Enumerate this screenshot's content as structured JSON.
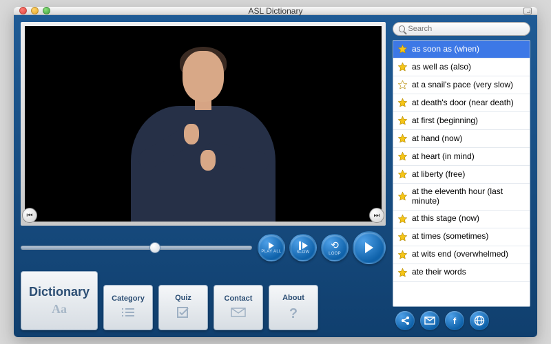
{
  "window": {
    "title": "ASL Dictionary"
  },
  "search": {
    "placeholder": "Search"
  },
  "controls": {
    "playall": "PLAY ALL",
    "slow": "SLOW",
    "loop": "LOOP"
  },
  "cards": {
    "dictionary": {
      "title": "Dictionary",
      "sub": "Aa"
    },
    "category": {
      "title": "Category"
    },
    "quiz": {
      "title": "Quiz"
    },
    "contact": {
      "title": "Contact"
    },
    "about": {
      "title": "About"
    }
  },
  "words": [
    {
      "label": "as soon as (when)",
      "favorite": true,
      "selected": true
    },
    {
      "label": "as well as (also)",
      "favorite": true,
      "selected": false
    },
    {
      "label": "at a snail's pace (very slow)",
      "favorite": false,
      "selected": false
    },
    {
      "label": "at death's door (near death)",
      "favorite": true,
      "selected": false
    },
    {
      "label": "at first (beginning)",
      "favorite": true,
      "selected": false
    },
    {
      "label": "at hand (now)",
      "favorite": true,
      "selected": false
    },
    {
      "label": "at heart (in mind)",
      "favorite": true,
      "selected": false
    },
    {
      "label": "at liberty (free)",
      "favorite": true,
      "selected": false
    },
    {
      "label": "at the eleventh hour (last minute)",
      "favorite": true,
      "selected": false
    },
    {
      "label": "at this stage (now)",
      "favorite": true,
      "selected": false
    },
    {
      "label": "at times (sometimes)",
      "favorite": true,
      "selected": false
    },
    {
      "label": "at wits end (overwhelmed)",
      "favorite": true,
      "selected": false
    },
    {
      "label": "ate their words",
      "favorite": true,
      "selected": false
    }
  ],
  "share": {
    "share": "share-icon",
    "mail": "mail-icon",
    "fb": "facebook-icon",
    "globe": "globe-icon"
  }
}
